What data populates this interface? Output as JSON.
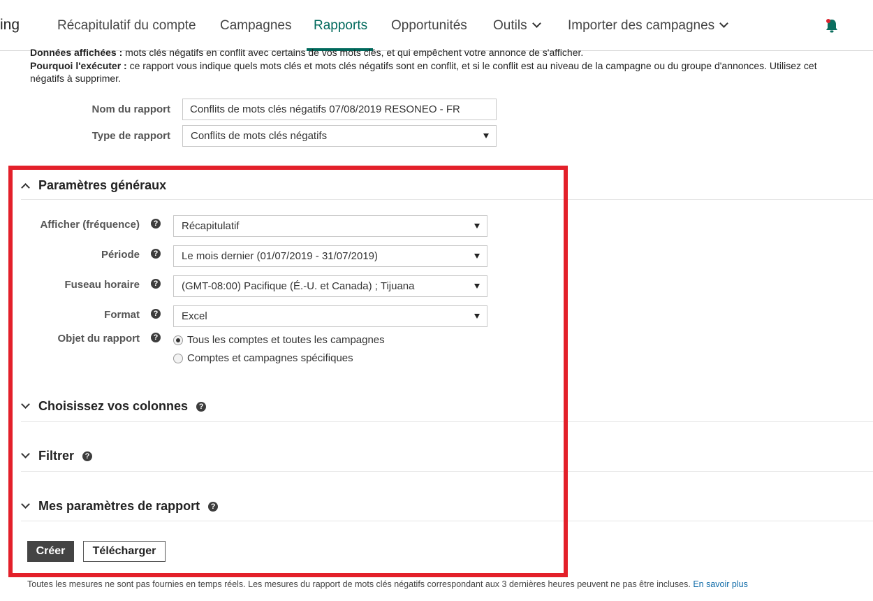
{
  "nav": {
    "brand": "ing",
    "items": [
      {
        "label": "Récapitulatif du compte"
      },
      {
        "label": "Campagnes"
      },
      {
        "label": "Rapports"
      },
      {
        "label": "Opportunités"
      },
      {
        "label": "Outils"
      },
      {
        "label": "Importer des campagnes"
      }
    ],
    "active_item": "Rapports",
    "accent_color": "#00695c",
    "bell_icon": "bell-icon"
  },
  "description": {
    "line1_label": "Données affichées :",
    "line1_text": " mots clés négatifs en conflit avec certains de vos mots clés, et qui empêchent votre annonce de s'afficher.",
    "line2_label": "Pourquoi l'exécuter :",
    "line2_text": " ce rapport vous indique quels mots clés et mots clés négatifs sont en conflit, et si le conflit est au niveau de la campagne ou du groupe d'annonces. Utilisez cet",
    "line3_text": "négatifs à supprimer."
  },
  "report": {
    "name_label": "Nom du rapport",
    "name_value": "Conflits de mots clés négatifs 07/08/2019 RESONEO - FR",
    "type_label": "Type de rapport",
    "type_value": "Conflits de mots clés négatifs"
  },
  "general": {
    "title": "Paramètres généraux",
    "frequency_label": "Afficher (fréquence)",
    "frequency_value": "Récapitulatif",
    "period_label": "Période",
    "period_value": "Le mois dernier (01/07/2019 - 31/07/2019)",
    "timezone_label": "Fuseau horaire",
    "timezone_value": "(GMT-08:00) Pacifique (É.-U. et Canada) ; Tijuana",
    "format_label": "Format",
    "format_value": "Excel",
    "scope_label": "Objet du rapport",
    "scope_options": [
      {
        "label": "Tous les comptes et toutes les campagnes",
        "checked": true
      },
      {
        "label": "Comptes et campagnes spécifiques",
        "checked": false
      }
    ]
  },
  "sections": {
    "columns_title": "Choisissez vos colonnes",
    "filter_title": "Filtrer",
    "settings_title": "Mes paramètres de rapport"
  },
  "help_glyph": "?",
  "actions": {
    "create_label": "Créer",
    "download_label": "Télécharger"
  },
  "footer": {
    "note": "Toutes les mesures ne sont pas fournies en temps réels. Les mesures du rapport de mots clés négatifs correspondant aux 3 dernières heures peuvent ne pas être incluses. ",
    "link": "En savoir plus"
  },
  "colors": {
    "highlight_frame": "#e3202a",
    "primary_button": "#444444",
    "link": "#0f6ba8"
  }
}
